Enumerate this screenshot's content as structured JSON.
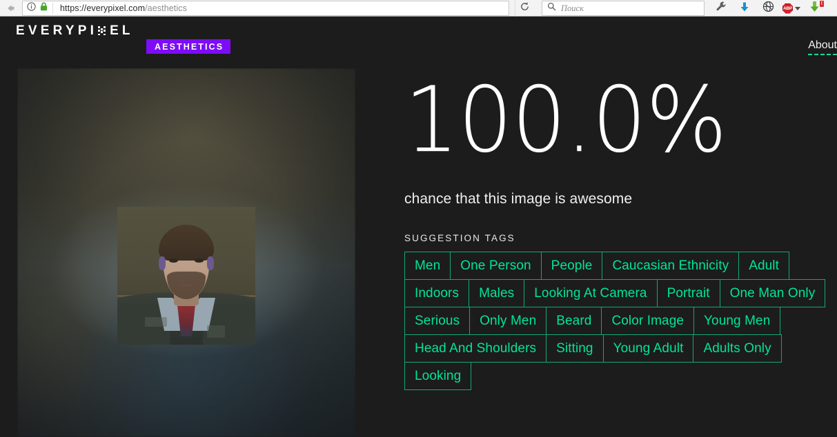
{
  "browser": {
    "back_icon": "back-arrow-icon",
    "identity_info_icon": "info-circle-icon",
    "lock_icon": "padlock-icon",
    "url_domain": "https://everypixel.com",
    "url_path": "/aesthetics",
    "reload_icon": "reload-icon",
    "search_placeholder": "Поиск",
    "search_icon": "search-icon",
    "toolbar": [
      {
        "name": "wrench-icon",
        "label": ""
      },
      {
        "name": "download-arrow-icon",
        "label": ""
      },
      {
        "name": "globe-icon",
        "label": ""
      },
      {
        "name": "adblock-plus-icon",
        "label": "ABP"
      },
      {
        "name": "downloads-icon",
        "label": ""
      }
    ],
    "download_badge": "!"
  },
  "header": {
    "logo_left": "EVERYPI",
    "logo_right": "EL",
    "logo_x_icon": "pixel-x-icon",
    "badge": "AESTHETICS",
    "about_link": "About",
    "badge_color": "#7d0cf7"
  },
  "image_panel": {
    "thumbnail_name": "analyzed-photo",
    "backdrop_name": "blurred-photo-backdrop"
  },
  "results": {
    "score": "100.0%",
    "score_caption": "chance that this image is awesome",
    "tags_label": "SUGGESTION TAGS",
    "tag_color": "#00e597",
    "tags": [
      "Men",
      "One Person",
      "People",
      "Caucasian Ethnicity",
      "Adult",
      "Indoors",
      "Males",
      "Looking At Camera",
      "Portrait",
      "One Man Only",
      "Serious",
      "Only Men",
      "Beard",
      "Color Image",
      "Young Men",
      "Head And Shoulders",
      "Sitting",
      "Young Adult",
      "Adults Only",
      "Looking"
    ]
  }
}
